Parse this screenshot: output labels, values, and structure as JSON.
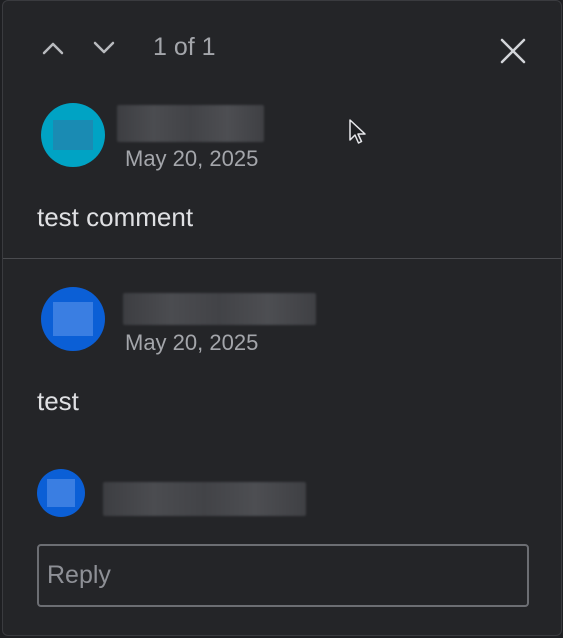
{
  "header": {
    "counter": "1 of 1",
    "prev_icon": "chevron-up-icon",
    "next_icon": "chevron-down-icon",
    "close_icon": "close-icon"
  },
  "comments": [
    {
      "avatar_color": "#00a3c4",
      "date": "May 20, 2025",
      "text": "test comment"
    },
    {
      "avatar_color": "#0b5fd6",
      "date": "May 20, 2025",
      "text": "test"
    }
  ],
  "reply": {
    "avatar_color": "#0b5fd6",
    "placeholder": "Reply",
    "value": ""
  },
  "colors": {
    "background": "#242528",
    "text": "#dfe0e3",
    "muted": "#a4a6ab",
    "border": "#6c6e73"
  }
}
